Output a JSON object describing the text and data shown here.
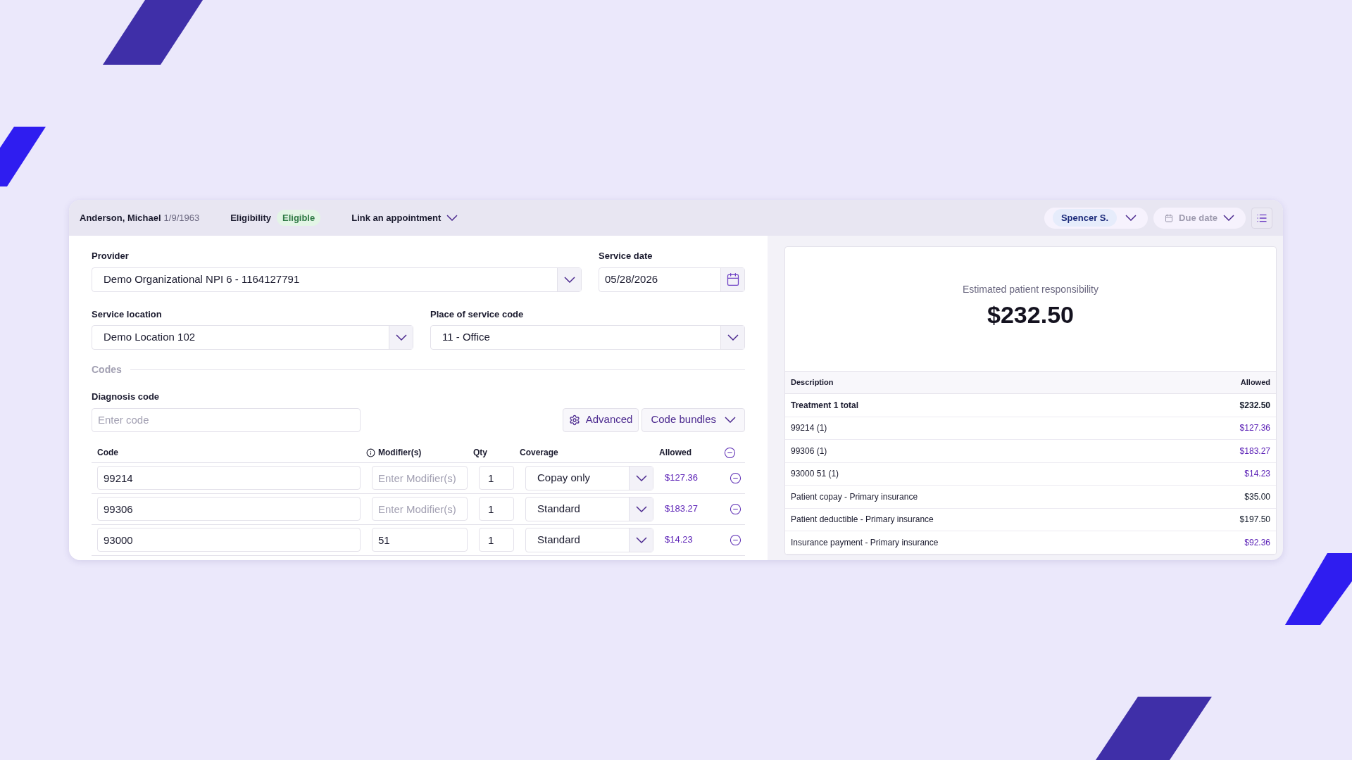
{
  "header": {
    "patient_name": "Anderson, Michael",
    "dob": "1/9/1963",
    "eligibility_label": "Eligibility",
    "eligibility_badge": "Eligible",
    "link_appointment": "Link an appointment",
    "assignee": "Spencer S.",
    "due_date": "Due date"
  },
  "form": {
    "provider": {
      "label": "Provider",
      "value": "Demo Organizational NPI 6 - 1164127791"
    },
    "service_date": {
      "label": "Service date",
      "value": "05/28/2026"
    },
    "service_location": {
      "label": "Service location",
      "value": "Demo Location 102"
    },
    "place_of_service": {
      "label": "Place of service code",
      "value": "11 - Office"
    },
    "codes_heading": "Codes",
    "diagnosis": {
      "label": "Diagnosis code",
      "placeholder": "Enter code"
    },
    "advanced_button": "Advanced",
    "code_bundles_button": "Code bundles",
    "columns": [
      "Code",
      "Modifier(s)",
      "Qty",
      "Coverage",
      "Allowed"
    ],
    "rows": [
      {
        "code": "99214",
        "modifier_placeholder": "Enter Modifier(s)",
        "qty": "1",
        "coverage": "Copay only",
        "allowed": "$127.36"
      },
      {
        "code": "99306",
        "modifier_placeholder": "Enter Modifier(s)",
        "qty": "1",
        "coverage": "Standard",
        "allowed": "$183.27"
      },
      {
        "code": "93000",
        "modifier": "51",
        "qty": "1",
        "coverage": "Standard",
        "allowed": "$14.23"
      }
    ]
  },
  "summary": {
    "label": "Estimated patient responsibility",
    "amount": "$232.50",
    "columns": [
      "Description",
      "Allowed"
    ],
    "rows": [
      {
        "description": "Treatment 1 total",
        "allowed": "$232.50",
        "bold": true,
        "color": "#111827"
      },
      {
        "description": "99214 (1)",
        "allowed": "$127.36",
        "bold": false,
        "color": "#5b21b6"
      },
      {
        "description": "99306 (1)",
        "allowed": "$183.27",
        "bold": false,
        "color": "#5b21b6"
      },
      {
        "description": "93000 51 (1)",
        "allowed": "$14.23",
        "bold": false,
        "color": "#5b21b6"
      },
      {
        "description": "Patient copay - Primary insurance",
        "allowed": "$35.00",
        "bold": false,
        "color": "#111827"
      },
      {
        "description": "Patient deductible - Primary insurance",
        "allowed": "$197.50",
        "bold": false,
        "color": "#111827"
      },
      {
        "description": "Insurance payment - Primary insurance",
        "allowed": "$92.36",
        "bold": false,
        "color": "#5b21b6"
      }
    ]
  }
}
